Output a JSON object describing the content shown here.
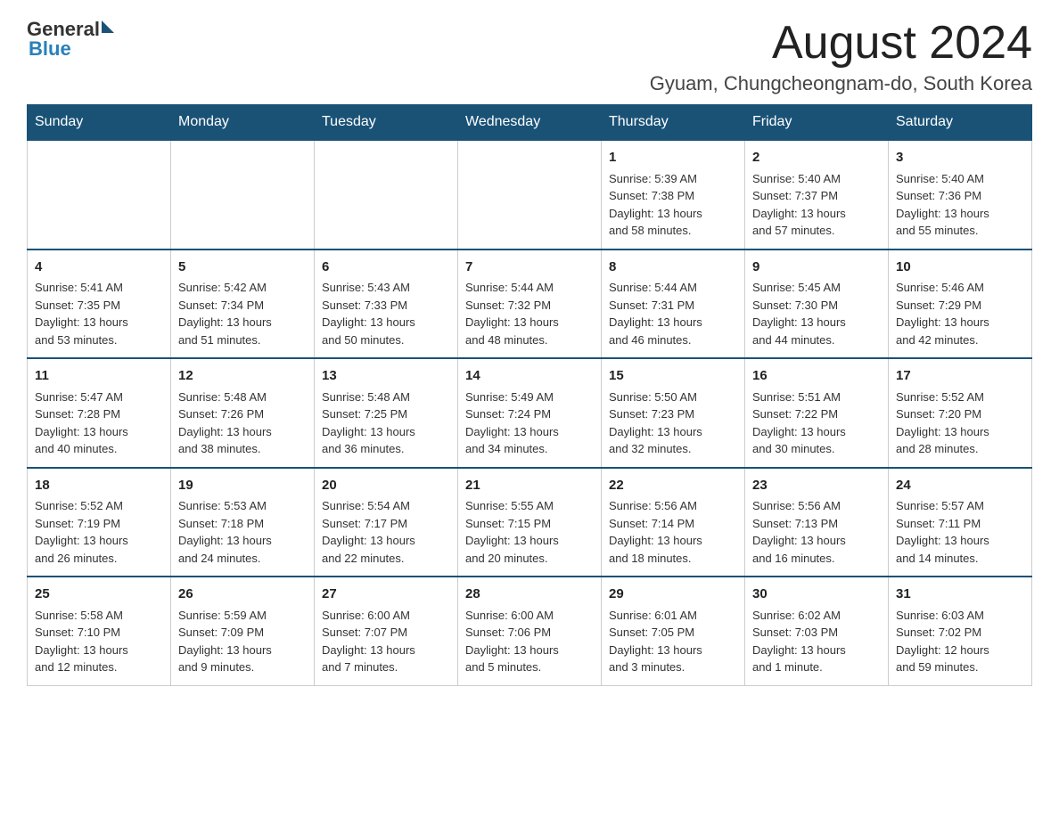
{
  "header": {
    "logo_general": "General",
    "logo_blue": "Blue",
    "month_title": "August 2024",
    "location": "Gyuam, Chungcheongnam-do, South Korea"
  },
  "weekdays": [
    "Sunday",
    "Monday",
    "Tuesday",
    "Wednesday",
    "Thursday",
    "Friday",
    "Saturday"
  ],
  "weeks": [
    [
      {
        "day": "",
        "info": ""
      },
      {
        "day": "",
        "info": ""
      },
      {
        "day": "",
        "info": ""
      },
      {
        "day": "",
        "info": ""
      },
      {
        "day": "1",
        "info": "Sunrise: 5:39 AM\nSunset: 7:38 PM\nDaylight: 13 hours\nand 58 minutes."
      },
      {
        "day": "2",
        "info": "Sunrise: 5:40 AM\nSunset: 7:37 PM\nDaylight: 13 hours\nand 57 minutes."
      },
      {
        "day": "3",
        "info": "Sunrise: 5:40 AM\nSunset: 7:36 PM\nDaylight: 13 hours\nand 55 minutes."
      }
    ],
    [
      {
        "day": "4",
        "info": "Sunrise: 5:41 AM\nSunset: 7:35 PM\nDaylight: 13 hours\nand 53 minutes."
      },
      {
        "day": "5",
        "info": "Sunrise: 5:42 AM\nSunset: 7:34 PM\nDaylight: 13 hours\nand 51 minutes."
      },
      {
        "day": "6",
        "info": "Sunrise: 5:43 AM\nSunset: 7:33 PM\nDaylight: 13 hours\nand 50 minutes."
      },
      {
        "day": "7",
        "info": "Sunrise: 5:44 AM\nSunset: 7:32 PM\nDaylight: 13 hours\nand 48 minutes."
      },
      {
        "day": "8",
        "info": "Sunrise: 5:44 AM\nSunset: 7:31 PM\nDaylight: 13 hours\nand 46 minutes."
      },
      {
        "day": "9",
        "info": "Sunrise: 5:45 AM\nSunset: 7:30 PM\nDaylight: 13 hours\nand 44 minutes."
      },
      {
        "day": "10",
        "info": "Sunrise: 5:46 AM\nSunset: 7:29 PM\nDaylight: 13 hours\nand 42 minutes."
      }
    ],
    [
      {
        "day": "11",
        "info": "Sunrise: 5:47 AM\nSunset: 7:28 PM\nDaylight: 13 hours\nand 40 minutes."
      },
      {
        "day": "12",
        "info": "Sunrise: 5:48 AM\nSunset: 7:26 PM\nDaylight: 13 hours\nand 38 minutes."
      },
      {
        "day": "13",
        "info": "Sunrise: 5:48 AM\nSunset: 7:25 PM\nDaylight: 13 hours\nand 36 minutes."
      },
      {
        "day": "14",
        "info": "Sunrise: 5:49 AM\nSunset: 7:24 PM\nDaylight: 13 hours\nand 34 minutes."
      },
      {
        "day": "15",
        "info": "Sunrise: 5:50 AM\nSunset: 7:23 PM\nDaylight: 13 hours\nand 32 minutes."
      },
      {
        "day": "16",
        "info": "Sunrise: 5:51 AM\nSunset: 7:22 PM\nDaylight: 13 hours\nand 30 minutes."
      },
      {
        "day": "17",
        "info": "Sunrise: 5:52 AM\nSunset: 7:20 PM\nDaylight: 13 hours\nand 28 minutes."
      }
    ],
    [
      {
        "day": "18",
        "info": "Sunrise: 5:52 AM\nSunset: 7:19 PM\nDaylight: 13 hours\nand 26 minutes."
      },
      {
        "day": "19",
        "info": "Sunrise: 5:53 AM\nSunset: 7:18 PM\nDaylight: 13 hours\nand 24 minutes."
      },
      {
        "day": "20",
        "info": "Sunrise: 5:54 AM\nSunset: 7:17 PM\nDaylight: 13 hours\nand 22 minutes."
      },
      {
        "day": "21",
        "info": "Sunrise: 5:55 AM\nSunset: 7:15 PM\nDaylight: 13 hours\nand 20 minutes."
      },
      {
        "day": "22",
        "info": "Sunrise: 5:56 AM\nSunset: 7:14 PM\nDaylight: 13 hours\nand 18 minutes."
      },
      {
        "day": "23",
        "info": "Sunrise: 5:56 AM\nSunset: 7:13 PM\nDaylight: 13 hours\nand 16 minutes."
      },
      {
        "day": "24",
        "info": "Sunrise: 5:57 AM\nSunset: 7:11 PM\nDaylight: 13 hours\nand 14 minutes."
      }
    ],
    [
      {
        "day": "25",
        "info": "Sunrise: 5:58 AM\nSunset: 7:10 PM\nDaylight: 13 hours\nand 12 minutes."
      },
      {
        "day": "26",
        "info": "Sunrise: 5:59 AM\nSunset: 7:09 PM\nDaylight: 13 hours\nand 9 minutes."
      },
      {
        "day": "27",
        "info": "Sunrise: 6:00 AM\nSunset: 7:07 PM\nDaylight: 13 hours\nand 7 minutes."
      },
      {
        "day": "28",
        "info": "Sunrise: 6:00 AM\nSunset: 7:06 PM\nDaylight: 13 hours\nand 5 minutes."
      },
      {
        "day": "29",
        "info": "Sunrise: 6:01 AM\nSunset: 7:05 PM\nDaylight: 13 hours\nand 3 minutes."
      },
      {
        "day": "30",
        "info": "Sunrise: 6:02 AM\nSunset: 7:03 PM\nDaylight: 13 hours\nand 1 minute."
      },
      {
        "day": "31",
        "info": "Sunrise: 6:03 AM\nSunset: 7:02 PM\nDaylight: 12 hours\nand 59 minutes."
      }
    ]
  ]
}
